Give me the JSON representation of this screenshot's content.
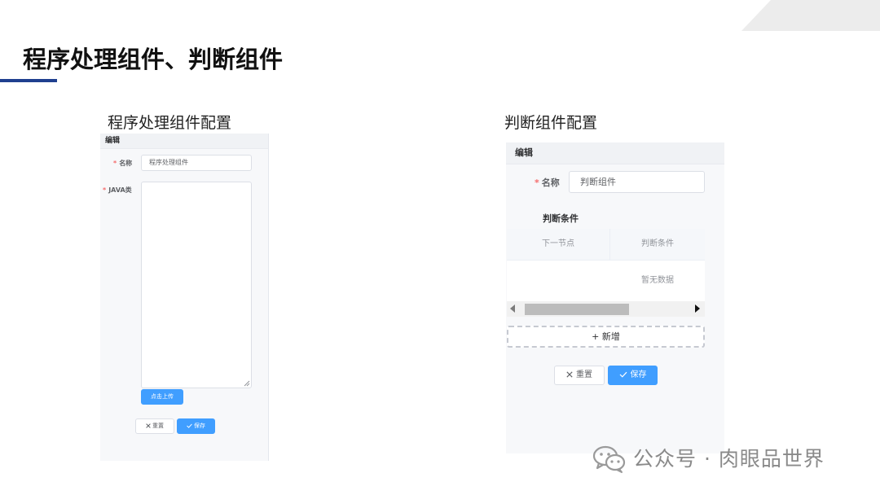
{
  "slide": {
    "title": "程序处理组件、判断组件"
  },
  "left_section": {
    "caption": "程序处理组件配置",
    "panel": {
      "header": "编辑",
      "name_label": "名称",
      "name_value": "程序处理组件",
      "java_label": "JAVA类",
      "upload_button": "点击上传",
      "reset_button": "重置",
      "save_button": "保存"
    }
  },
  "right_section": {
    "caption": "判断组件配置",
    "panel": {
      "header": "编辑",
      "name_label": "名称",
      "name_value": "判断组件",
      "conditions_title": "判断条件",
      "table": {
        "columns": [
          "下一节点",
          "判断条件"
        ],
        "empty_text": "暂无数据"
      },
      "add_button": "+ 新增",
      "reset_button": "重置",
      "save_button": "保存"
    }
  },
  "watermark": {
    "text": "公众号 · 肉眼品世界"
  },
  "colors": {
    "primary": "#409eff",
    "required": "#f56c6c",
    "title_underline": "#1f3f8f"
  },
  "icons": {
    "close": "close-icon",
    "check": "check-icon",
    "wechat": "wechat-icon"
  }
}
